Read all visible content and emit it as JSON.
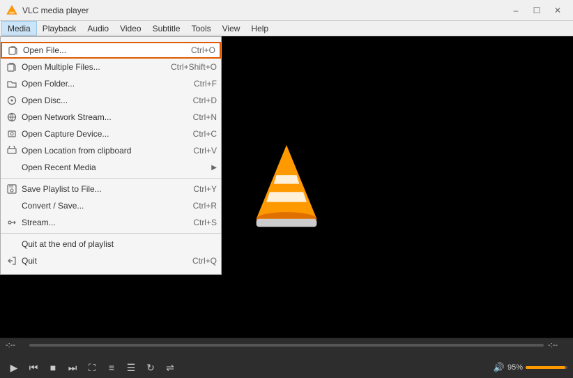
{
  "titlebar": {
    "title": "VLC media player",
    "min_label": "–",
    "max_label": "☐",
    "close_label": "✕"
  },
  "menubar": {
    "items": [
      {
        "id": "media",
        "label": "Media",
        "active": true
      },
      {
        "id": "playback",
        "label": "Playback",
        "active": false
      },
      {
        "id": "audio",
        "label": "Audio",
        "active": false
      },
      {
        "id": "video",
        "label": "Video",
        "active": false
      },
      {
        "id": "subtitle",
        "label": "Subtitle",
        "active": false
      },
      {
        "id": "tools",
        "label": "Tools",
        "active": false
      },
      {
        "id": "view",
        "label": "View",
        "active": false
      },
      {
        "id": "help",
        "label": "Help",
        "active": false
      }
    ]
  },
  "dropdown": {
    "sections": [
      {
        "items": [
          {
            "id": "open-file",
            "label": "Open File...",
            "shortcut": "Ctrl+O",
            "highlighted": true
          },
          {
            "id": "open-multiple",
            "label": "Open Multiple Files...",
            "shortcut": "Ctrl+Shift+O"
          },
          {
            "id": "open-folder",
            "label": "Open Folder...",
            "shortcut": "Ctrl+F"
          },
          {
            "id": "open-disc",
            "label": "Open Disc...",
            "shortcut": "Ctrl+D"
          },
          {
            "id": "open-network",
            "label": "Open Network Stream...",
            "shortcut": "Ctrl+N"
          },
          {
            "id": "open-capture",
            "label": "Open Capture Device...",
            "shortcut": "Ctrl+C"
          },
          {
            "id": "open-location",
            "label": "Open Location from clipboard",
            "shortcut": "Ctrl+V"
          },
          {
            "id": "open-recent",
            "label": "Open Recent Media",
            "shortcut": "",
            "arrow": true
          }
        ]
      },
      {
        "items": [
          {
            "id": "save-playlist",
            "label": "Save Playlist to File...",
            "shortcut": "Ctrl+Y"
          },
          {
            "id": "convert",
            "label": "Convert / Save...",
            "shortcut": "Ctrl+R"
          },
          {
            "id": "stream",
            "label": "Stream...",
            "shortcut": "Ctrl+S"
          }
        ]
      },
      {
        "items": [
          {
            "id": "quit-end",
            "label": "Quit at the end of playlist",
            "shortcut": ""
          },
          {
            "id": "quit",
            "label": "Quit",
            "shortcut": "Ctrl+Q"
          }
        ]
      }
    ]
  },
  "player": {
    "time_left": "-:--",
    "time_right": "-:--",
    "volume": "95%"
  }
}
